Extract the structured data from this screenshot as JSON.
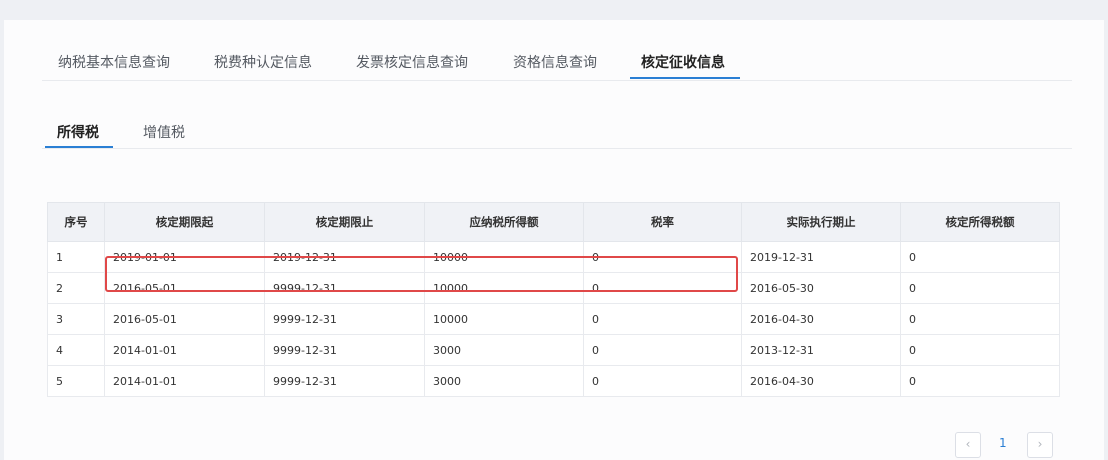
{
  "top_tabs": [
    {
      "label": "纳税基本信息查询"
    },
    {
      "label": "税费种认定信息"
    },
    {
      "label": "发票核定信息查询"
    },
    {
      "label": "资格信息查询"
    },
    {
      "label": "核定征收信息"
    }
  ],
  "top_tabs_active_index": 4,
  "sub_tabs": [
    {
      "label": "所得税"
    },
    {
      "label": "增值税"
    }
  ],
  "sub_tabs_active_index": 0,
  "table": {
    "headers": [
      "序号",
      "核定期限起",
      "核定期限止",
      "应纳税所得额",
      "税率",
      "实际执行期止",
      "核定所得税额"
    ],
    "rows": [
      [
        "1",
        "2019-01-01",
        "2019-12-31",
        "10000",
        "0",
        "2019-12-31",
        "0"
      ],
      [
        "2",
        "2016-05-01",
        "9999-12-31",
        "10000",
        "0",
        "2016-05-30",
        "0"
      ],
      [
        "3",
        "2016-05-01",
        "9999-12-31",
        "10000",
        "0",
        "2016-04-30",
        "0"
      ],
      [
        "4",
        "2014-01-01",
        "9999-12-31",
        "3000",
        "0",
        "2013-12-31",
        "0"
      ],
      [
        "5",
        "2014-01-01",
        "9999-12-31",
        "3000",
        "0",
        "2016-04-30",
        "0"
      ]
    ]
  },
  "highlight": {
    "row": 1,
    "color": "#e04848"
  },
  "pagination": {
    "prev": "‹",
    "current_page": "1",
    "next": "›"
  },
  "colors": {
    "accent": "#2a7fd4",
    "highlight": "#e04848",
    "header_bg": "#f0f2f6"
  }
}
